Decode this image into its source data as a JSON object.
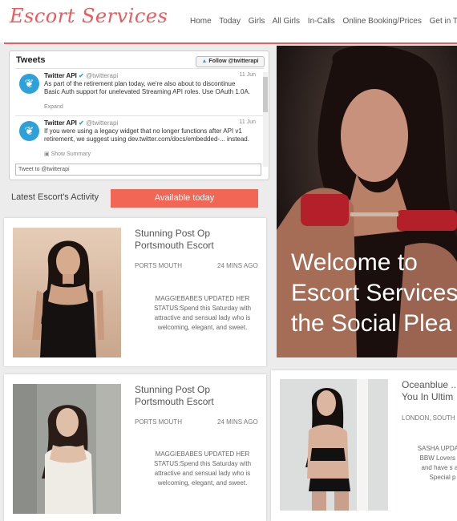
{
  "header": {
    "logo": "Escort Services",
    "nav": [
      "Home",
      "Today",
      "Girls",
      "All Girls",
      "In-Calls",
      "Online Booking/Prices",
      "Get in Touch"
    ]
  },
  "tweets": {
    "title": "Tweets",
    "follow_label": "Follow @twitterapi",
    "items": [
      {
        "name": "Twitter API",
        "handle": "@twitterapi",
        "date": "11 Jun",
        "text": "As part of the retirement plan today, we're also about to discontinue Basic Auth support for unelevated Streaming API roles. Use OAuth 1.0A.",
        "link": "Expand"
      },
      {
        "name": "Twitter API",
        "handle": "@twitterapi",
        "date": "11 Jun",
        "text": "If you were using a legacy widget that no longer functions after API v1 retirement, we suggest using dev.twitter.com/docs/embedded-... instead.",
        "link": "Show Summary"
      }
    ],
    "input_placeholder": "Tweet to @twitterapi"
  },
  "activity": {
    "label": "Latest Escort's Activity",
    "button": "Available today"
  },
  "cards": [
    {
      "title": "Stunning Post Op Portsmouth Escort",
      "location": "PORTS MOUTH",
      "time": "24 MINS AGO",
      "desc": "MAGGIEBABES UPDATED HER STATUS:Spend this Saturday with attractive and sensual lady who is welcoming, elegant, and sweet."
    },
    {
      "title": "Stunning Post Op Portsmouth Escort",
      "location": "PORTS MOUTH",
      "time": "24 MINS AGO",
      "desc": "MAGGIEBABES UPDATED HER STATUS:Spend this Saturday with attractive and sensual lady who is welcoming, elegant, and sweet."
    },
    {
      "title": "Oceanblue ... You In Ultim",
      "location": "LONDON, SOUTH",
      "time": "",
      "desc": "SASHA UPDAT you BBW Lovers CUM and have s at my Special p H"
    }
  ],
  "hero": {
    "line1": "Welcome to",
    "line2": "Escort Services",
    "line3": "the Social Plea"
  },
  "colors": {
    "accent": "#f0595c",
    "button": "#f16655",
    "twitter": "#2ea0da"
  }
}
